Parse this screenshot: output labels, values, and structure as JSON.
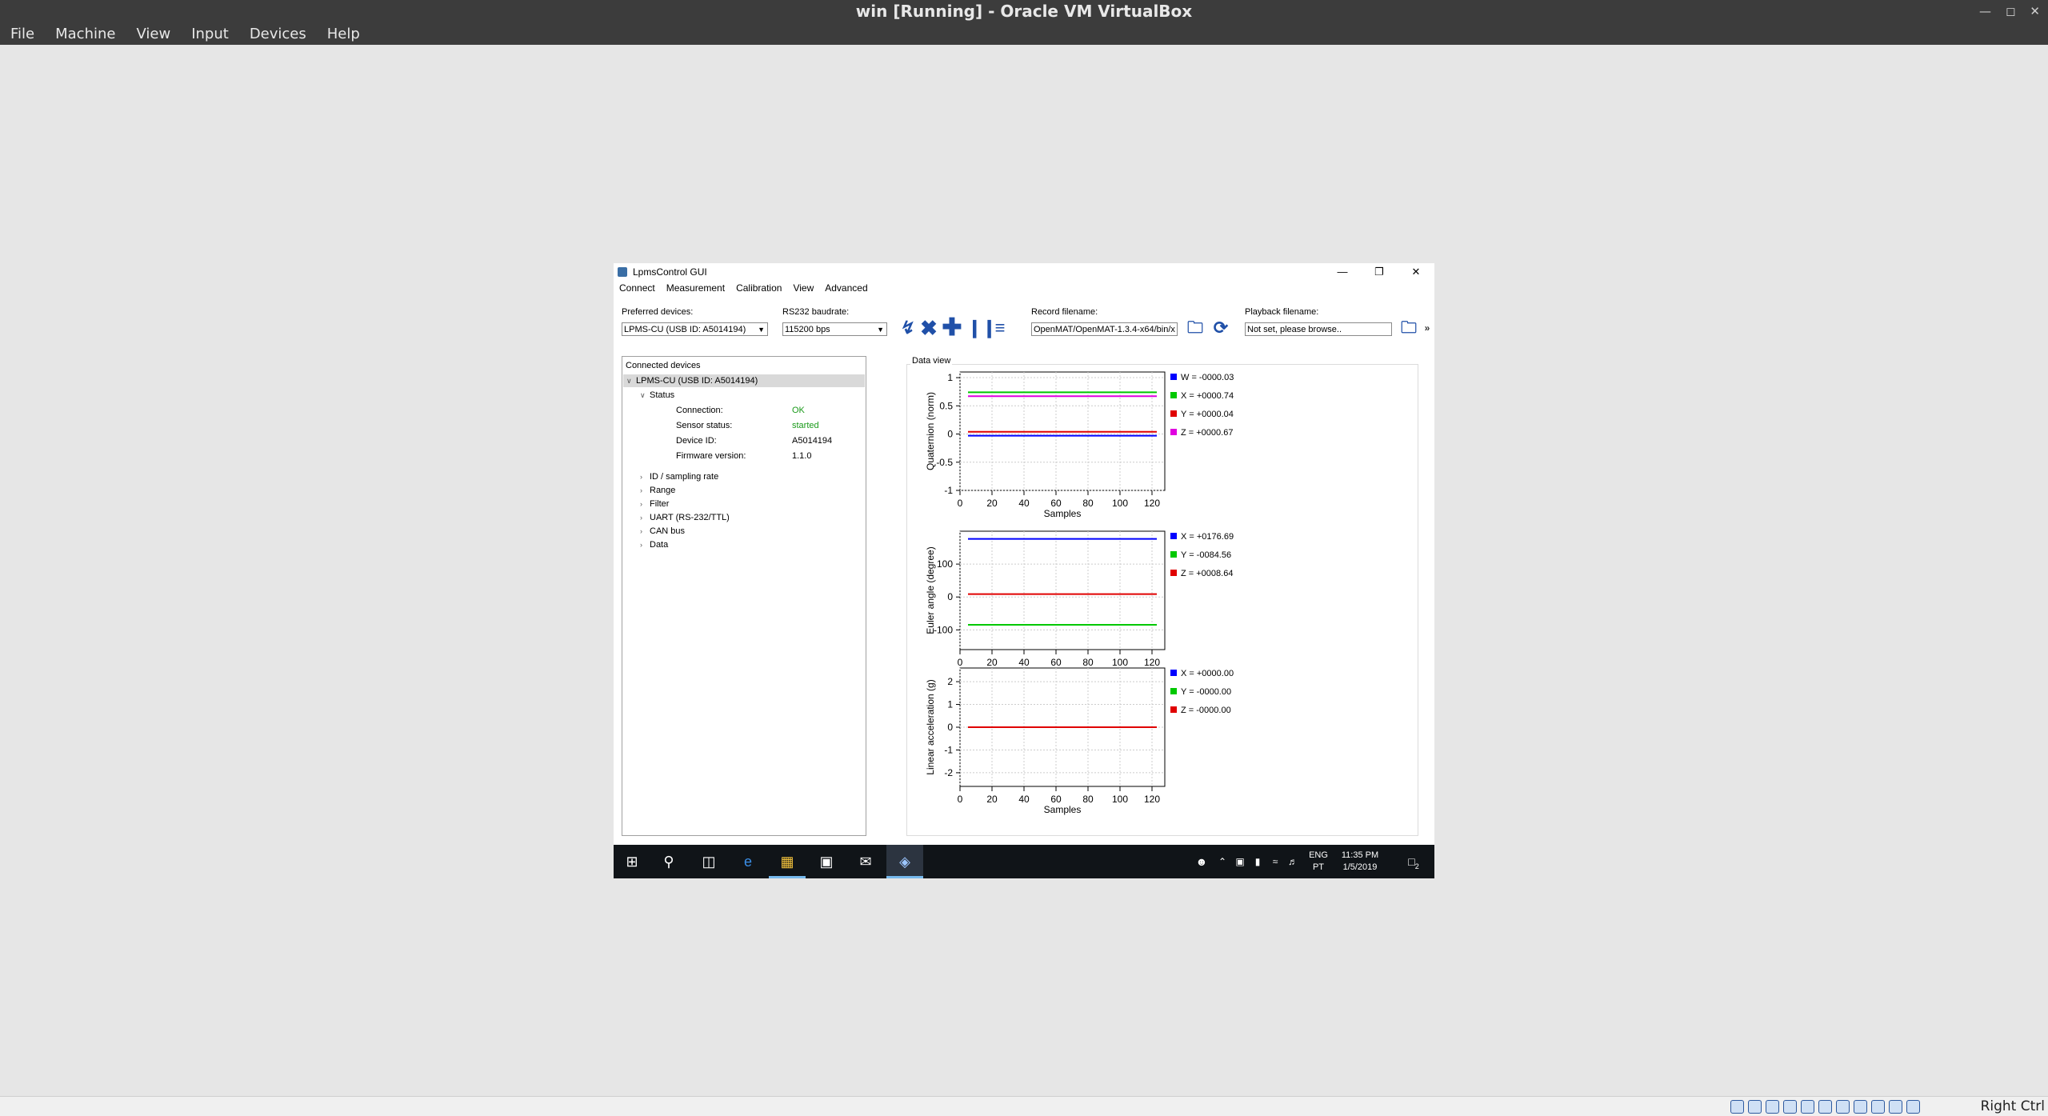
{
  "host": {
    "title": "win [Running] - Oracle VM VirtualBox",
    "menu": [
      "File",
      "Machine",
      "View",
      "Input",
      "Devices",
      "Help"
    ],
    "host_key": "Right Ctrl"
  },
  "app": {
    "title": "LpmsControl GUI",
    "menu": [
      "Connect",
      "Measurement",
      "Calibration",
      "View",
      "Advanced"
    ],
    "toolbar": {
      "preferred_label": "Preferred devices:",
      "preferred_value": "LPMS-CU (USB ID: A5014194)",
      "baud_label": "RS232 baudrate:",
      "baud_value": "115200 bps",
      "record_label": "Record filename:",
      "record_value": "OpenMAT/OpenMAT-1.3.4-x64/bin/x",
      "playback_label": "Playback filename:",
      "playback_value": "Not set, please browse.."
    },
    "devices": {
      "header": "Connected devices",
      "device": "LPMS-CU (USB ID: A5014194)",
      "status": "Status",
      "fields": [
        {
          "label": "Connection:",
          "value": "OK"
        },
        {
          "label": "Sensor status:",
          "value": "started"
        },
        {
          "label": "Device ID:",
          "value": "A5014194"
        },
        {
          "label": "Firmware version:",
          "value": "1.1.0"
        }
      ],
      "groups": [
        "ID / sampling rate",
        "Range",
        "Filter",
        "UART (RS-232/TTL)",
        "CAN bus",
        "Data"
      ]
    },
    "data_view_label": "Data view"
  },
  "chart_data": [
    {
      "type": "line",
      "ylabel": "Quaternion (norm)",
      "xlabel": "Samples",
      "xlim": [
        0,
        128
      ],
      "ylim": [
        -1,
        1.1
      ],
      "yticks": [
        "1",
        "0.5",
        "0",
        "-0.5",
        "-1"
      ],
      "xticks": [
        "0",
        "20",
        "40",
        "60",
        "80",
        "100",
        "120"
      ],
      "series": [
        {
          "name": "W = -0000.03",
          "color": "#0000ff",
          "values": [
            -0.03,
            -0.03
          ]
        },
        {
          "name": "X = +0000.74",
          "color": "#00c800",
          "values": [
            0.74,
            0.74
          ]
        },
        {
          "name": "Y = +0000.04",
          "color": "#e00000",
          "values": [
            0.04,
            0.04
          ]
        },
        {
          "name": "Z = +0000.67",
          "color": "#e000e0",
          "values": [
            0.67,
            0.67
          ]
        }
      ]
    },
    {
      "type": "line",
      "ylabel": "Euler angle (degree)",
      "xlabel": "Samples",
      "xlim": [
        0,
        128
      ],
      "ylim": [
        -160,
        200
      ],
      "yticks": [
        "100",
        "0",
        "-100"
      ],
      "xticks": [
        "0",
        "20",
        "40",
        "60",
        "80",
        "100",
        "120"
      ],
      "series": [
        {
          "name": "X = +0176.69",
          "color": "#0000ff",
          "values": [
            176.69,
            176.69
          ]
        },
        {
          "name": "Y = -0084.56",
          "color": "#00c800",
          "values": [
            -84.56,
            -84.56
          ]
        },
        {
          "name": "Z = +0008.64",
          "color": "#e00000",
          "values": [
            8.64,
            8.64
          ]
        }
      ]
    },
    {
      "type": "line",
      "ylabel": "Linear acceleration (g)",
      "xlabel": "Samples",
      "xlim": [
        0,
        128
      ],
      "ylim": [
        -2.6,
        2.6
      ],
      "yticks": [
        "2",
        "1",
        "0",
        "-1",
        "-2"
      ],
      "xticks": [
        "0",
        "20",
        "40",
        "60",
        "80",
        "100",
        "120"
      ],
      "series": [
        {
          "name": "X = +0000.00",
          "color": "#0000ff",
          "values": [
            0.0,
            0.0
          ]
        },
        {
          "name": "Y = -0000.00",
          "color": "#00c800",
          "values": [
            0.0,
            0.0
          ]
        },
        {
          "name": "Z = -0000.00",
          "color": "#e00000",
          "values": [
            0.0,
            0.0
          ]
        }
      ]
    }
  ],
  "taskbar": {
    "lang": "ENG",
    "layout": "PT",
    "time": "11:35 PM",
    "date": "1/5/2019",
    "notifications": "2"
  }
}
